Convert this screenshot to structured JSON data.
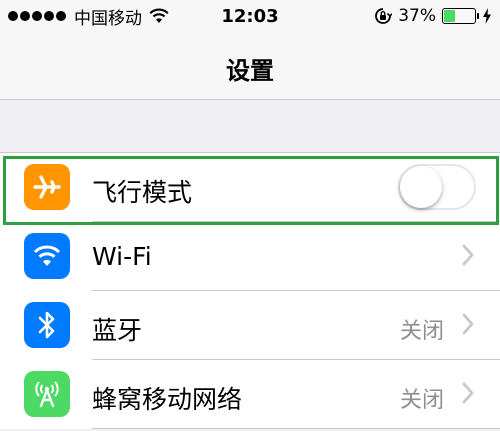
{
  "status_bar": {
    "carrier": "中国移动",
    "time": "12:03",
    "battery_percent": "37%",
    "battery_level": 0.37
  },
  "nav": {
    "title": "设置"
  },
  "settings": [
    {
      "label": "飞行模式",
      "icon": "airplane-icon",
      "icon_color": "#ff9500",
      "control": "toggle",
      "toggle_on": false
    },
    {
      "label": "Wi-Fi",
      "icon": "wifi-icon",
      "icon_color": "#007aff",
      "value": ""
    },
    {
      "label": "蓝牙",
      "icon": "bluetooth-icon",
      "icon_color": "#007aff",
      "value": "关闭"
    },
    {
      "label": "蜂窝移动网络",
      "icon": "cellular-icon",
      "icon_color": "#4cd964",
      "value": "关闭"
    }
  ],
  "colors": {
    "highlight": "#2e9e3e",
    "toggle_off_border": "#e5e5ea"
  }
}
